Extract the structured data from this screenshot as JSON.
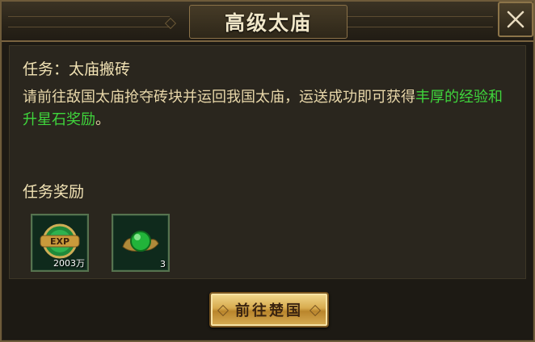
{
  "header": {
    "title": "高级太庙"
  },
  "quest": {
    "name": "任务：太庙搬砖",
    "description_plain": "请前往敌国太庙抢夺砖块并运回我国太庙，运送成功即可获得",
    "description_highlight": "丰厚的经验和升星石奖励",
    "description_end": "。",
    "highlight_color": "#3fd53c"
  },
  "rewards": {
    "title": "任务奖励",
    "items": [
      {
        "icon": "exp-icon",
        "label": "EXP",
        "count": "2003万"
      },
      {
        "icon": "star-stone-icon",
        "count": "3"
      }
    ]
  },
  "action": {
    "go_button_label": "前往楚国"
  },
  "colors": {
    "text_main": "#e9d8aa",
    "frame_gold": "#8c7449",
    "button_gold": "#d8ab4e"
  }
}
